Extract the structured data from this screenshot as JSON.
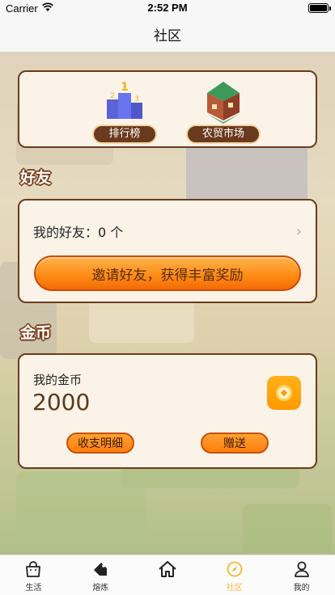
{
  "status_bar": {
    "carrier": "Carrier",
    "time": "2:52 PM"
  },
  "nav": {
    "title": "社区"
  },
  "features": [
    {
      "label": "排行榜",
      "icon": "leaderboard-podium-icon"
    },
    {
      "label": "农贸市场",
      "icon": "market-building-icon"
    }
  ],
  "friends": {
    "section_title": "好友",
    "my_friends_label": "我的好友：0 个",
    "invite_button": "邀请好友，获得丰富奖励"
  },
  "coins": {
    "section_title": "金币",
    "label": "我的金币",
    "value": "2000",
    "details_button": "收支明细",
    "gift_button": "赠送"
  },
  "tabs": [
    {
      "label": "生活",
      "icon": "shopping-bag-icon",
      "active": false
    },
    {
      "label": "熔炼",
      "icon": "tag-icon",
      "active": false
    },
    {
      "label": "",
      "icon": "home-icon",
      "active": false
    },
    {
      "label": "社区",
      "icon": "compass-icon",
      "active": true
    },
    {
      "label": "我的",
      "icon": "user-icon",
      "active": false
    }
  ],
  "colors": {
    "accent": "#ff8a14",
    "card_border": "#6d3a1c",
    "card_bg": "#fbf3e8",
    "tab_active": "#f0b93a"
  }
}
